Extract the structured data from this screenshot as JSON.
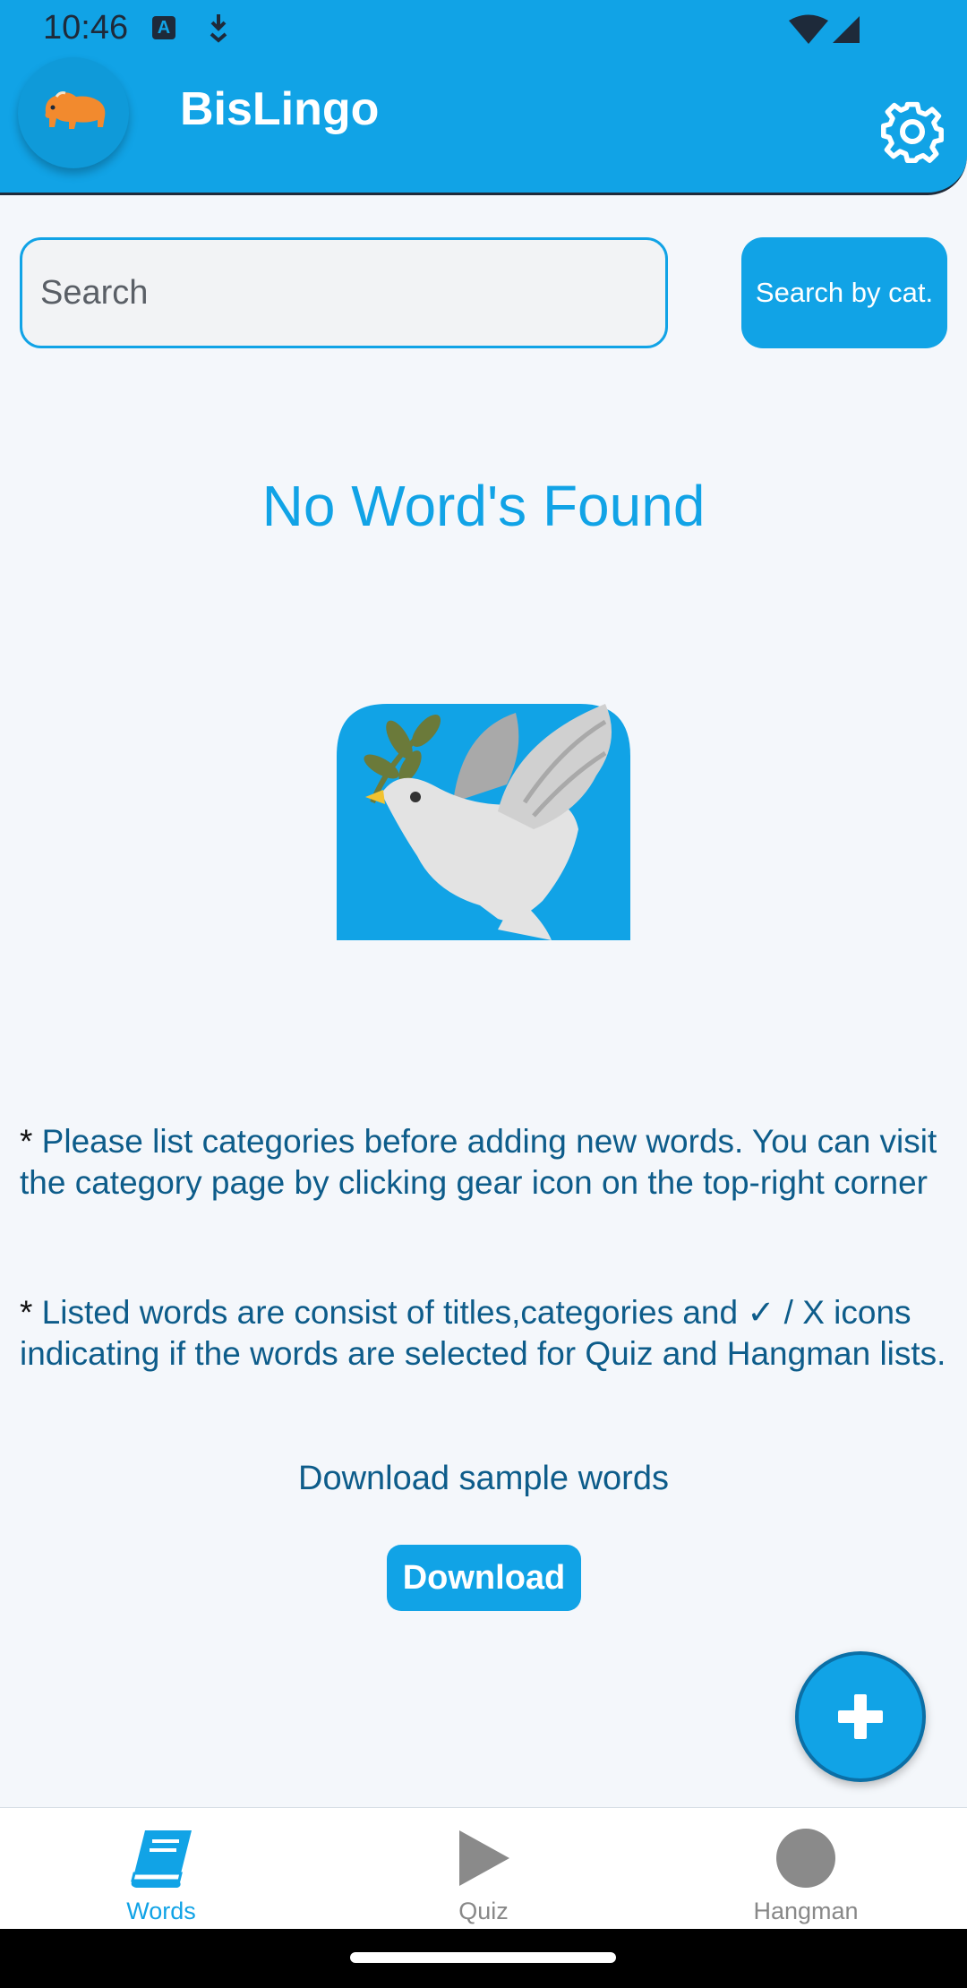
{
  "status_bar": {
    "time": "10:46",
    "icons": [
      "text-a-icon",
      "download-icon",
      "wifi-icon",
      "cellular-signal-icon"
    ]
  },
  "header": {
    "title": "BisLingo",
    "logo_icon": "bison-icon",
    "settings_icon": "gear-icon"
  },
  "search": {
    "placeholder": "Search",
    "category_button_label": "Search by cat."
  },
  "empty_state": {
    "title": "No Word's Found",
    "illustration": "dove-with-olive-branch"
  },
  "info": {
    "note_1_star": "*",
    "note_1": " Please list categories before adding new words. You can visit the category page by clicking gear icon on the top-right corner",
    "note_2_star": "*",
    "note_2": " Listed words are consist of titles,categories and ✓ / X icons indicating if the words are selected for Quiz and Hangman lists."
  },
  "download": {
    "label": "Download sample words",
    "button": "Download"
  },
  "fab": {
    "icon": "plus-icon"
  },
  "bottom_nav": {
    "items": [
      {
        "label": "Words",
        "icon": "book-icon",
        "active": true
      },
      {
        "label": "Quiz",
        "icon": "play-icon",
        "active": false
      },
      {
        "label": "Hangman",
        "icon": "circle-icon",
        "active": false
      }
    ]
  },
  "colors": {
    "primary": "#11a3e6",
    "background": "#f4f7fb",
    "text_dark_blue": "#0d5c8a",
    "inactive_nav": "#888888"
  }
}
